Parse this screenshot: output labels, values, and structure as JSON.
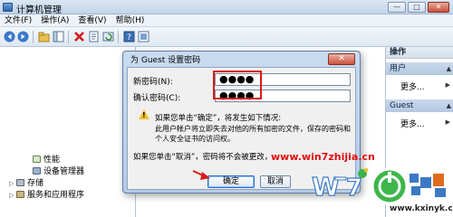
{
  "window": {
    "title": "计算机管理"
  },
  "window_controls": {
    "minimize": "—",
    "maximize": "□",
    "close": "✕"
  },
  "menubar": {
    "items": [
      "文件(F)",
      "操作(A)",
      "查看(V)",
      "帮助(H)"
    ]
  },
  "toolbar": {
    "icons": [
      "back-icon",
      "forward-icon",
      "up-folder-icon",
      "show-hide-tree-icon",
      "delete-icon",
      "properties-icon",
      "refresh-icon",
      "help-icon",
      "details-icon"
    ]
  },
  "tree": {
    "items": [
      {
        "label": "性能",
        "icon": "performance-icon"
      },
      {
        "label": "设备管理器",
        "icon": "device-manager-icon"
      },
      {
        "label": "存储",
        "icon": "storage-icon"
      },
      {
        "label": "服务和应用程序",
        "icon": "services-icon"
      }
    ]
  },
  "actions": {
    "header": "操作",
    "sections": [
      {
        "title": "用户",
        "more": "更多..."
      },
      {
        "title": "Guest",
        "more": "更多..."
      }
    ]
  },
  "dialog": {
    "title": "为 Guest 设置密码",
    "close_label": "✕",
    "new_password_label": "新密码(N):",
    "new_password_value": "●●●●",
    "confirm_password_label": "确认密码(C):",
    "confirm_password_value": "●●●●",
    "warning_heading": "如果您单击“确定”，将发生如下情况:",
    "warning_line1": "此用户帐户将立即失去对他的所有加密的文件，保存的密码和",
    "warning_line2": "个人安全证书的访问权。",
    "cancel_note": "如果您单击“取消”，密码将不会被更改，",
    "ok_label": "确定",
    "cancel_label": "取消"
  },
  "watermark": {
    "url": "www.win7zhijia.cn",
    "site_url": "www.kxinyk.com"
  },
  "colors": {
    "highlight_box": "#d71a1a",
    "watermark_red": "#e01010",
    "dialog_frame": "#b6cbe6",
    "actions_subheader": "#b3c8e2"
  }
}
